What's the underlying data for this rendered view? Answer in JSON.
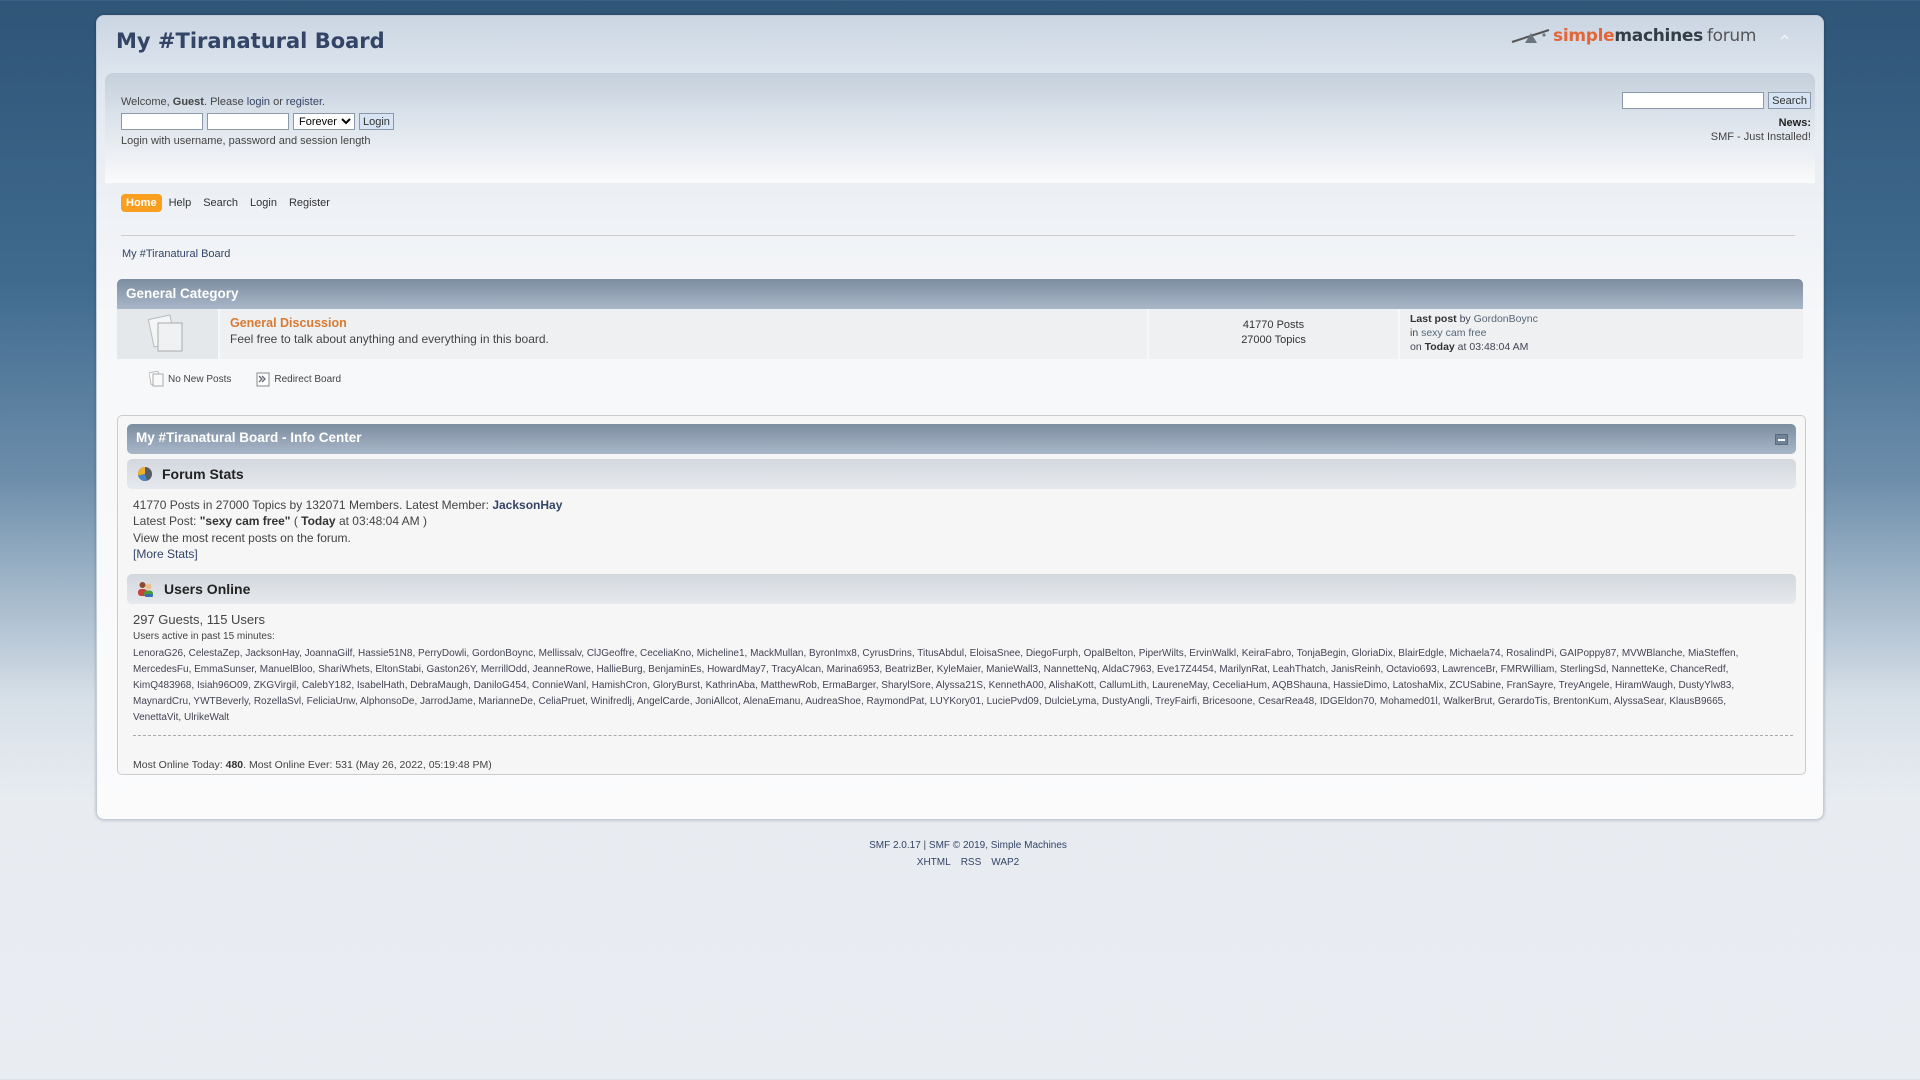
{
  "header": {
    "forum_title": "My #Tiranatural Board",
    "logo": {
      "simple": "simple",
      "machines": "machines",
      "forum": "forum"
    },
    "upshrink_icon": "chevron-up"
  },
  "user_area": {
    "welcome_prefix": "Welcome, ",
    "guest": "Guest",
    "please": ". Please ",
    "login_link": "login",
    "or": " or ",
    "register_link": "register",
    "period": ".",
    "username_value": "",
    "password_value": "",
    "session_length_selected": "Forever",
    "login_button": "Login",
    "hint": "Login with username, password and session length"
  },
  "news_area": {
    "search_value": "",
    "search_button": "Search",
    "news_title": "News:",
    "news_text": "SMF - Just Installed!"
  },
  "menu": {
    "items": [
      {
        "label": "Home",
        "active": true
      },
      {
        "label": "Help",
        "active": false
      },
      {
        "label": "Search",
        "active": false
      },
      {
        "label": "Login",
        "active": false
      },
      {
        "label": "Register",
        "active": false
      }
    ]
  },
  "linktree": {
    "label": "My #Tiranatural Board"
  },
  "category": {
    "title": "General Category",
    "boards": [
      {
        "name": "General Discussion",
        "description": "Feel free to talk about anything and everything in this board.",
        "posts": "41770 Posts",
        "topics": "27000 Topics",
        "last_post_label": "Last post",
        "last_post_by": " by ",
        "last_post_user": "GordonBoync",
        "last_post_in": "in ",
        "last_post_topic": "sexy cam free",
        "last_post_on": "on ",
        "last_post_today": "Today",
        "last_post_time": " at 03:48:04 AM"
      }
    ]
  },
  "legend": {
    "no_new_posts": "No New Posts",
    "redirect_board": "Redirect Board"
  },
  "info_center": {
    "title": "My #Tiranatural Board - Info Center",
    "forum_stats": {
      "heading": "Forum Stats",
      "line1_prefix": "41770 Posts in 27000 Topics by 132071 Members. Latest Member: ",
      "latest_member": "JacksonHay",
      "latest_post_label": "Latest Post: ",
      "latest_post_title": "\"sexy cam free\"",
      "latest_post_open": " ( ",
      "latest_post_today": "Today",
      "latest_post_time": " at 03:48:04 AM )",
      "recent_posts_text": "View the most recent posts on the forum.",
      "more_stats": "[More Stats]"
    },
    "users_online": {
      "heading": "Users Online",
      "counts": "297 Guests, 115 Users",
      "active_label": "Users active in past 15 minutes:",
      "users": [
        "LenoraG26",
        "CelestaZep",
        "JacksonHay",
        "JoannaGilf",
        "Hassie51N8",
        "PerryDowli",
        "GordonBoync",
        "Mellissalv",
        "ClJGeoffre",
        "CeceliaKno",
        "Micheline1",
        "MackMullan",
        "ByronImx8",
        "CyrusDrins",
        "TitusAbdul",
        "EloisaSnee",
        "DiegoFurph",
        "OpalBelton",
        "PiperWilts",
        "ErvinWalkl",
        "KeiraFabro",
        "TonjaBegin",
        "GloriaDix",
        "BlairEdgle",
        "Michaela74",
        "RosalindPi",
        "GAIPoppy87",
        "MVWBlanche",
        "MiaSteffen",
        "MercedesFu",
        "EmmaSunser",
        "ManuelBloo",
        "ShariWhets",
        "EltonStabi",
        "Gaston26Y",
        "MerrillOdd",
        "JeanneRowe",
        "HallieBurg",
        "BenjaminEs",
        "HowardMay7",
        "TracyAlcan",
        "Marina6953",
        "BeatrizBer",
        "KyleMaier",
        "ManieWall3",
        "NannetteNq",
        "AldaC7963",
        "Eve17Z4454",
        "MarilynRat",
        "LeahThatch",
        "JanisReinh",
        "Octavio693",
        "LawrenceBr",
        "FMRWilliam",
        "SterlingSd",
        "NannetteKe",
        "ChanceRedf",
        "KimQ483968",
        "Isiah96O09",
        "ZKGVirgil",
        "CalebY182",
        "IsabelHath",
        "DebraMaugh",
        "DaniloG454",
        "ConnieWanl",
        "HamishCron",
        "GloryBurst",
        "KathrinAba",
        "MatthewRob",
        "ErmaBarger",
        "SharylSore",
        "Alyssa21S",
        "KennethA00",
        "AlishaKott",
        "CallumLith",
        "LaureneMay",
        "CeceliaHum",
        "AQBShauna",
        "HassieDimo",
        "LatoshaMix",
        "ZCUSabine",
        "FranSayre",
        "TreyAngele",
        "HiramWaugh",
        "DustyYlw83",
        "MaynardCru",
        "YWTBeverly",
        "RozellaSvl",
        "FeliciaUnw",
        "AlphonsoDe",
        "JarrodJame",
        "MarianneDe",
        "CeliaPruet",
        "Winifredlj",
        "AngelCarde",
        "JoniAllcot",
        "AlenaEmanu",
        "AudreaShoe",
        "RaymondPat",
        "LUYKory01",
        "LuciePvd09",
        "DulcieLyma",
        "DustyAngli",
        "TreyFairfi",
        "Bricesoone",
        "CesarRea48",
        "IDGEldon70",
        "Mohamed01l",
        "WalkerBrut",
        "GerardoTis",
        "BrentonKum",
        "AlyssaSear",
        "KlausB9665",
        "VenettaVit",
        "UlrikeWalt"
      ],
      "most_online_today_label": "Most Online Today: ",
      "most_online_today": "480",
      "most_online_ever": ". Most Online Ever: 531 (May 26, 2022, 05:19:48 PM)"
    }
  },
  "footer": {
    "version": "SMF 2.0.17",
    "sep": " | ",
    "copyright": "SMF © 2019",
    "comma": ", ",
    "company": "Simple Machines",
    "links": [
      "XHTML",
      "RSS",
      "WAP2"
    ]
  },
  "colors": {
    "accent_orange": "#f89f1f",
    "board_name": "#d87a31",
    "title_text": "#334466",
    "category_bar_top": "#7d8da0",
    "category_bar_bottom": "#a8b7c8"
  }
}
